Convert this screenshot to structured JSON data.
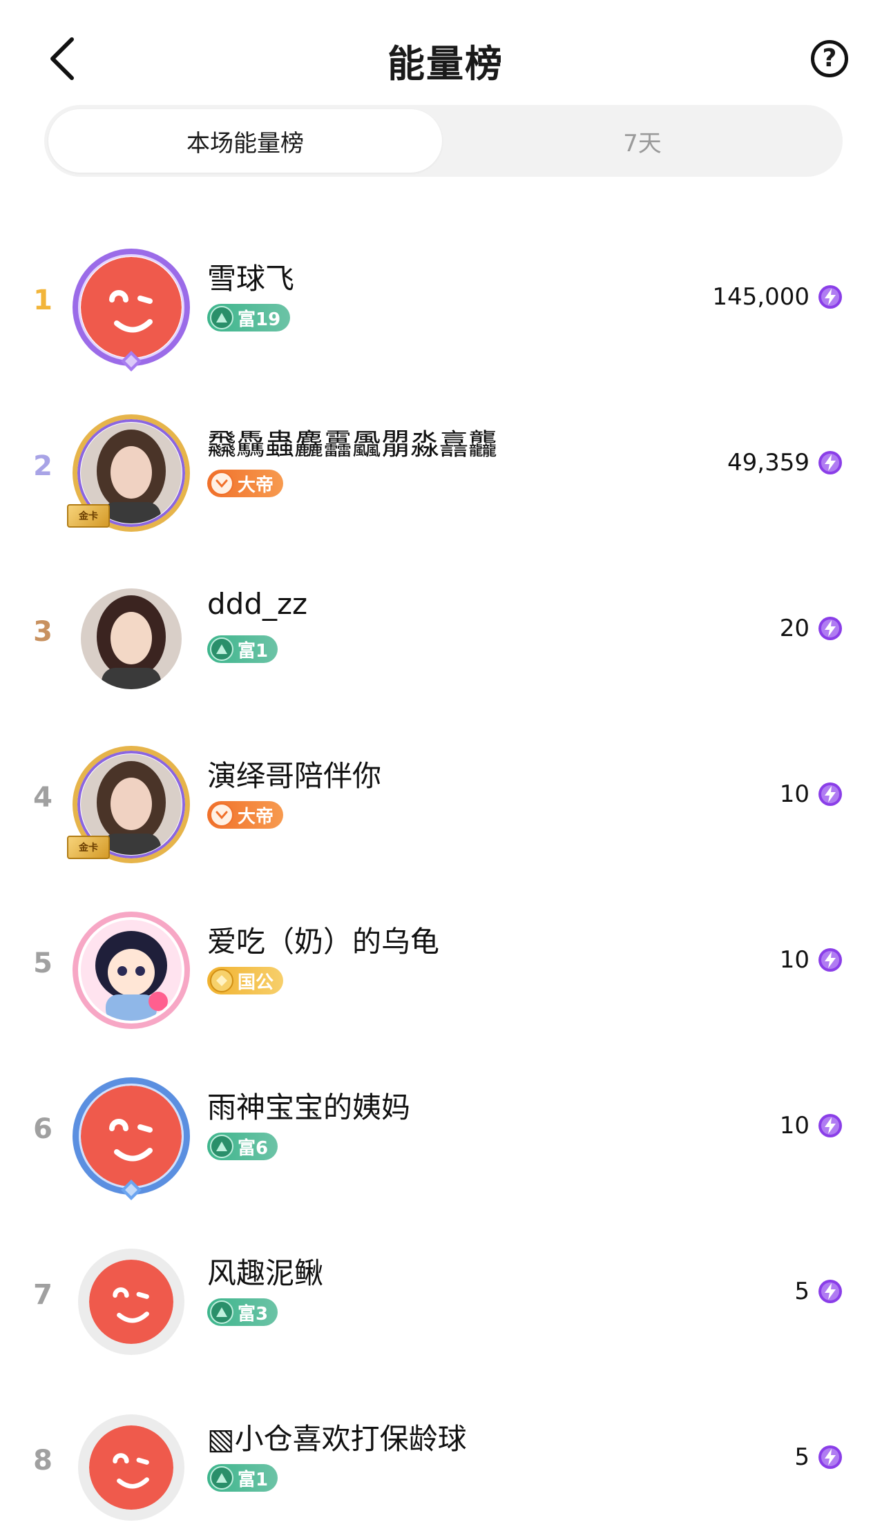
{
  "header": {
    "title": "能量榜",
    "help_label": "?"
  },
  "tabs": [
    {
      "label": "本场能量榜",
      "active": true
    },
    {
      "label": "7天",
      "active": false
    }
  ],
  "colors": {
    "rank1": "#f2b53a",
    "rank2": "#a8a3e6",
    "rank3": "#c8915f",
    "rank_other": "#a0a0a0",
    "energy": "#8a3ee8"
  },
  "rankings": [
    {
      "rank": "1",
      "name": "雪球飞",
      "badge": "富19",
      "badge_type": "wealth",
      "score": "145,000",
      "avatar": "default-avatar",
      "frame": "purple-crown-frame"
    },
    {
      "rank": "2",
      "name": "飝驫蟲麤靐飍朤淼譶龘",
      "badge": "大帝",
      "badge_type": "noble",
      "score": "49,359",
      "avatar": "photo-avatar",
      "frame": "gold-card-frame",
      "card_label": "金卡"
    },
    {
      "rank": "3",
      "name": "ddd_zz",
      "badge": "富1",
      "badge_type": "wealth",
      "score": "20",
      "avatar": "illustration-avatar",
      "frame": "none"
    },
    {
      "rank": "4",
      "name": "演绎哥陪伴你",
      "badge": "大帝",
      "badge_type": "noble",
      "score": "10",
      "avatar": "photo-avatar",
      "frame": "gold-card-frame",
      "card_label": "金卡"
    },
    {
      "rank": "5",
      "name": "爱吃（奶）的乌龟",
      "badge": "国公",
      "badge_type": "duke",
      "score": "10",
      "avatar": "cartoon-avatar",
      "frame": "pink-heart-frame"
    },
    {
      "rank": "6",
      "name": "雨神宝宝的姨妈",
      "badge": "富6",
      "badge_type": "wealth",
      "score": "10",
      "avatar": "default-avatar",
      "frame": "blue-frame"
    },
    {
      "rank": "7",
      "name": "风趣泥鳅",
      "badge": "富3",
      "badge_type": "wealth",
      "score": "5",
      "avatar": "default-avatar",
      "frame": "plain"
    },
    {
      "rank": "8",
      "name": "▧小仓喜欢打保龄球",
      "badge": "富1",
      "badge_type": "wealth",
      "score": "5",
      "avatar": "default-avatar",
      "frame": "plain"
    }
  ]
}
